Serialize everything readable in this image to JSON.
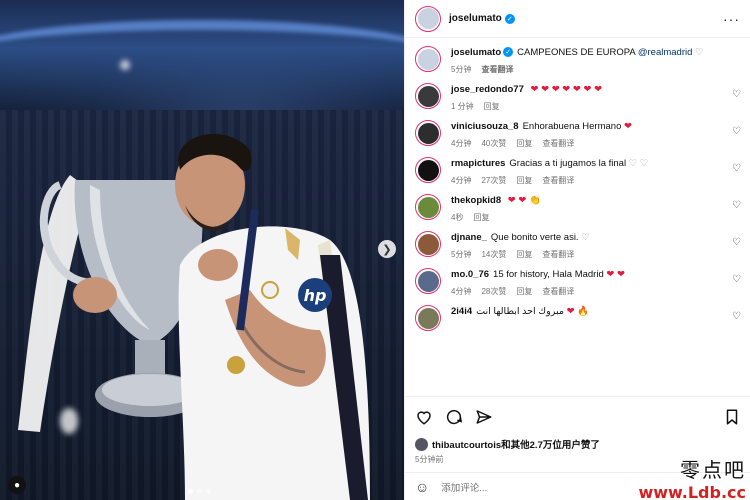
{
  "post": {
    "username": "joselumato",
    "caption_text": "CAMPEONES DE EUROPA",
    "caption_mention": "@realmadrid",
    "caption_time": "5分钟",
    "caption_translate": "查看翻译"
  },
  "photo": {
    "carousel_dots": 3,
    "active_dot": 0
  },
  "comments": [
    {
      "user": "jose_redondo77",
      "text": "",
      "emoji": "❤ ❤ ❤ ❤ ❤ ❤ ❤",
      "time": "1 分钟",
      "likes": "",
      "reply": "回复",
      "translate": "",
      "avatar_color": "#3a3a3a"
    },
    {
      "user": "viniciusouza_8",
      "text": "Enhorabuena Hermano",
      "emoji": "❤",
      "time": "4分钟",
      "likes": "40次赞",
      "reply": "回复",
      "translate": "查看翻译",
      "avatar_color": "#2d2d2d"
    },
    {
      "user": "rmapictures",
      "text": "Gracias a ti jugamos la final",
      "emoji": "♡ ♡",
      "time": "4分钟",
      "likes": "27次赞",
      "reply": "回复",
      "translate": "查看翻译",
      "avatar_color": "#111111"
    },
    {
      "user": "thekopkid8",
      "text": "",
      "emoji": "❤ ❤ 👏",
      "time": "4秒",
      "likes": "",
      "reply": "回复",
      "translate": "",
      "avatar_color": "#6b8a3a"
    },
    {
      "user": "djnane_",
      "text": "Que bonito verte asi.",
      "emoji": "♡",
      "time": "5分钟",
      "likes": "14次赞",
      "reply": "回复",
      "translate": "查看翻译",
      "avatar_color": "#8a5a3a"
    },
    {
      "user": "mo.0_76",
      "text": "15 for history, Hala Madrid",
      "emoji": "❤ ❤",
      "time": "4分钟",
      "likes": "28次赞",
      "reply": "回复",
      "translate": "查看翻译",
      "avatar_color": "#5a6a8a"
    },
    {
      "user": "2i4i4",
      "text": "مبروك احد ابطالها انت",
      "emoji": "❤ 🔥",
      "time": "",
      "likes": "",
      "reply": "",
      "translate": "",
      "avatar_color": "#7a7a5a"
    }
  ],
  "actions": {
    "liked_by_user": "thibautcourtois",
    "liked_by_text": "和其他2.7万位用户赞了",
    "post_time": "5分钟前"
  },
  "composer": {
    "placeholder": "添加评论..."
  },
  "watermark": {
    "cn": "零点吧",
    "url": "www.Ldb.cc"
  },
  "colors": {
    "accent_blue": "#0095f6",
    "heart_red": "#e21b3c",
    "story_ring": "#e1306c"
  }
}
